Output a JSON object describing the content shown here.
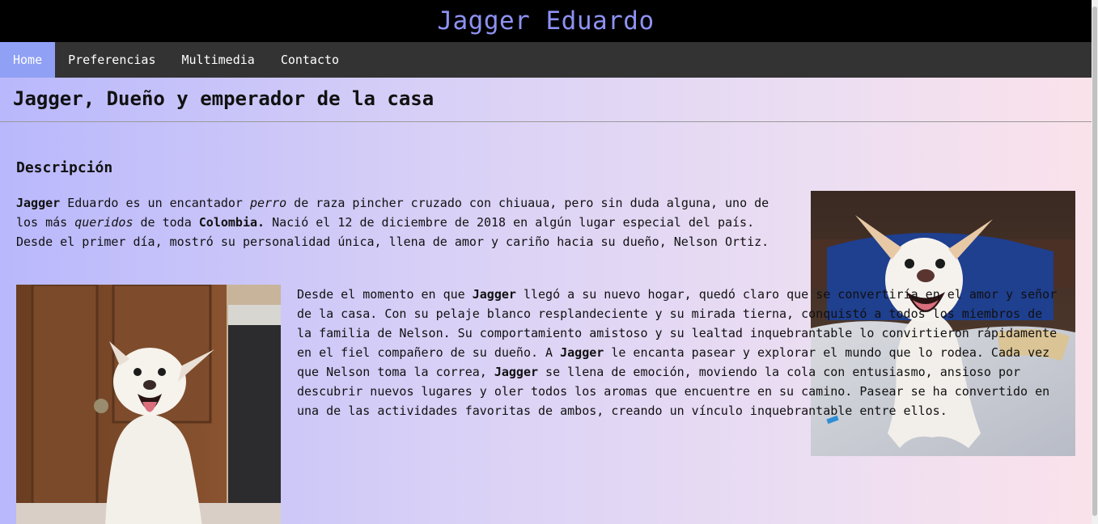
{
  "header": {
    "site_title": "Jagger Eduardo"
  },
  "nav": {
    "items": [
      {
        "label": "Home",
        "active": true
      },
      {
        "label": "Preferencias"
      },
      {
        "label": "Multimedia"
      },
      {
        "label": "Contacto"
      }
    ]
  },
  "page": {
    "subtitle": "Jagger, Dueño y emperador de la casa",
    "section_title": "Descripción",
    "intro": {
      "name": "Jagger",
      "p1": " Eduardo es un encantador ",
      "perro": "perro",
      "p2": " de raza pincher cruzado con chiuaua, pero sin duda alguna, uno de los más ",
      "queridos": "queridos",
      "p3": " de toda ",
      "colombia": "Colombia.",
      "p4": " Nació el 12 de diciembre de 2018 en algún lugar especial del país. Desde el primer día, mostró su personalidad única, llena de amor y cariño hacia su dueño, Nelson Ortiz."
    },
    "body": {
      "t1": "Desde el momento en que ",
      "name1": "Jagger",
      "t2": " llegó a su nuevo hogar, quedó claro que se convertiría en el amor y señor de la casa. Con su pelaje blanco resplandeciente y su mirada tierna, conquistó a todos los miembros de la familia de Nelson. Su comportamiento amistoso y su lealtad inquebrantable lo convirtieron rápidamente en el fiel compañero de su dueño. A ",
      "name2": "Jagger",
      "t3": " le encanta pasear y explorar el mundo que lo rodea. Cada vez que Nelson toma la correa, ",
      "name3": "Jagger",
      "t4": " se llena de emoción, moviendo la cola con entusiasmo, ansioso por descubrir nuevos lugares y oler todos los aromas que encuentre en su camino. Pasear se ha convertido en una de las actividades favoritas de ambos, creando un vínculo inquebrantable entre ellos."
    }
  },
  "colors": {
    "title": "#8e92f3",
    "nav_bg": "#333333",
    "nav_active": "#8fa0f5",
    "header_bg": "#000000"
  }
}
